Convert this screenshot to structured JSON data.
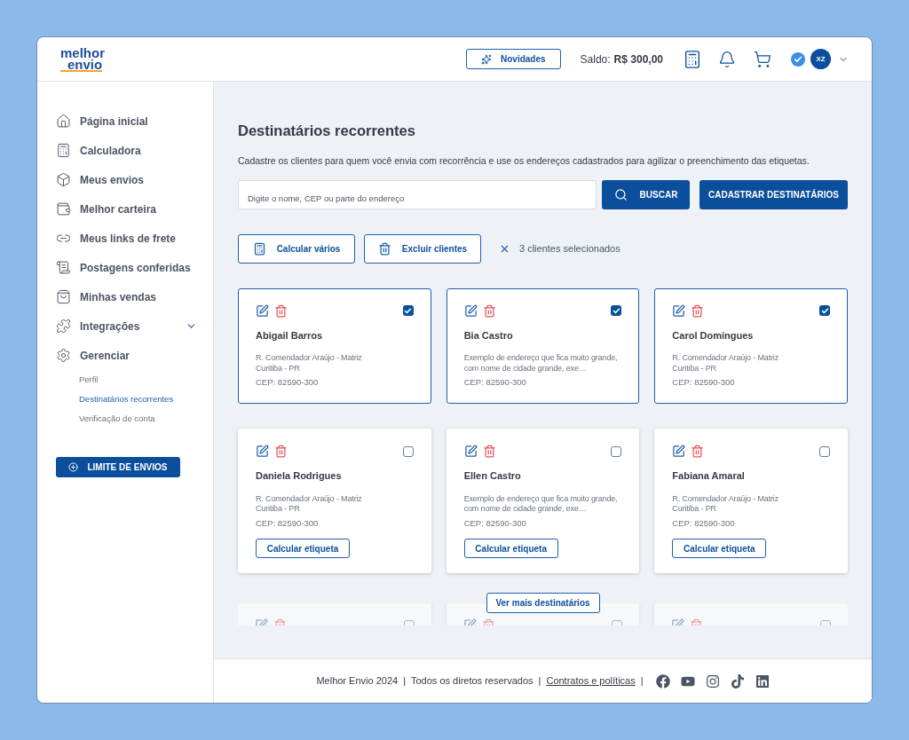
{
  "header": {
    "logo": [
      "melhor",
      "envio"
    ],
    "news_button": "Novidades",
    "balance_label": "Saldo:",
    "balance_value": "R$ 300,00",
    "verified": true,
    "avatar": "XZ"
  },
  "sidebar": {
    "items": [
      {
        "label": "Página inicial",
        "selected": false
      },
      {
        "label": "Calculadora",
        "selected": false
      },
      {
        "label": "Meus envios",
        "selected": false
      },
      {
        "label": "Melhor carteira",
        "selected": false
      },
      {
        "label": "Meus links de frete",
        "selected": false
      },
      {
        "label": "Postagens conferidas",
        "selected": false
      },
      {
        "label": "Minhas vendas",
        "selected": false
      },
      {
        "label": "Integrações",
        "selected": false,
        "expanded": false
      },
      {
        "label": "Gerenciar",
        "selected": false,
        "children": [
          {
            "label": "Perfil",
            "selected": false
          },
          {
            "label": "Destinatários recorrentes",
            "selected": true
          },
          {
            "label": "Verificação de conta",
            "selected": false
          }
        ]
      }
    ],
    "limit_button": "LIMITE DE ENVIOS"
  },
  "page": {
    "title": "Destinatários recorrentes",
    "description": "Cadastre os clientes para quem você envia com recorrência e use os endereços cadastrados para agilizar o preenchimento das etiquetas.",
    "search": {
      "placeholder": "Digite o nome, CEP ou parte do endereço"
    },
    "search_button": "BUSCAR",
    "register_button": "CADASTRAR DESTINATÁRIOS",
    "bulk_actions": [
      "Calcular vários",
      "Excluir clientes"
    ],
    "selection_text": "3 clientes selecionados",
    "cards": [
      {
        "name": "Abigail Barros",
        "address": "R. Comendador Araújo - Matriz",
        "city": "Curitiba - PR",
        "cep": "CEP: 82590-300",
        "checked": true
      },
      {
        "name": "Bia Castro",
        "address": "Exemplo de endereço que fica muito grande, com nome de cidade grande, exe…",
        "cep": "CEP: 82590-300",
        "checked": true
      },
      {
        "name": "Carol Domingues",
        "address": "R. Comendador Araújo - Matriz",
        "city": "Curitiba - PR",
        "cep": "CEP: 82590-300",
        "checked": true
      },
      {
        "name": "Daniela Rodrigues",
        "address": "R. Comendador Araújo - Matriz",
        "city": "Curitiba - PR",
        "cep": "CEP: 82590-300",
        "checked": false,
        "button": "Calcular etiqueta"
      },
      {
        "name": "Ellen Castro",
        "address": "Exemplo de endereço que fica muito grande, com nome de cidade grande, exe…",
        "cep": "CEP: 82590-300",
        "checked": false,
        "button": "Calcular etiqueta"
      },
      {
        "name": "Fabiana Amaral",
        "address": "R. Comendador Araújo - Matriz",
        "city": "Curitiba - PR",
        "cep": "CEP: 82590-300",
        "checked": false,
        "button": "Calcular etiqueta"
      }
    ],
    "faded_cards": [
      {
        "checked": false
      },
      {
        "checked": false
      },
      {
        "checked": false
      }
    ],
    "more_button": "Ver mais destinatários"
  },
  "footer": {
    "copyright": "Melhor Envio 2024",
    "rights": "Todos os diretos reservados",
    "link": "Contratos e políticas",
    "separators": [
      "|",
      "|",
      "|"
    ]
  }
}
